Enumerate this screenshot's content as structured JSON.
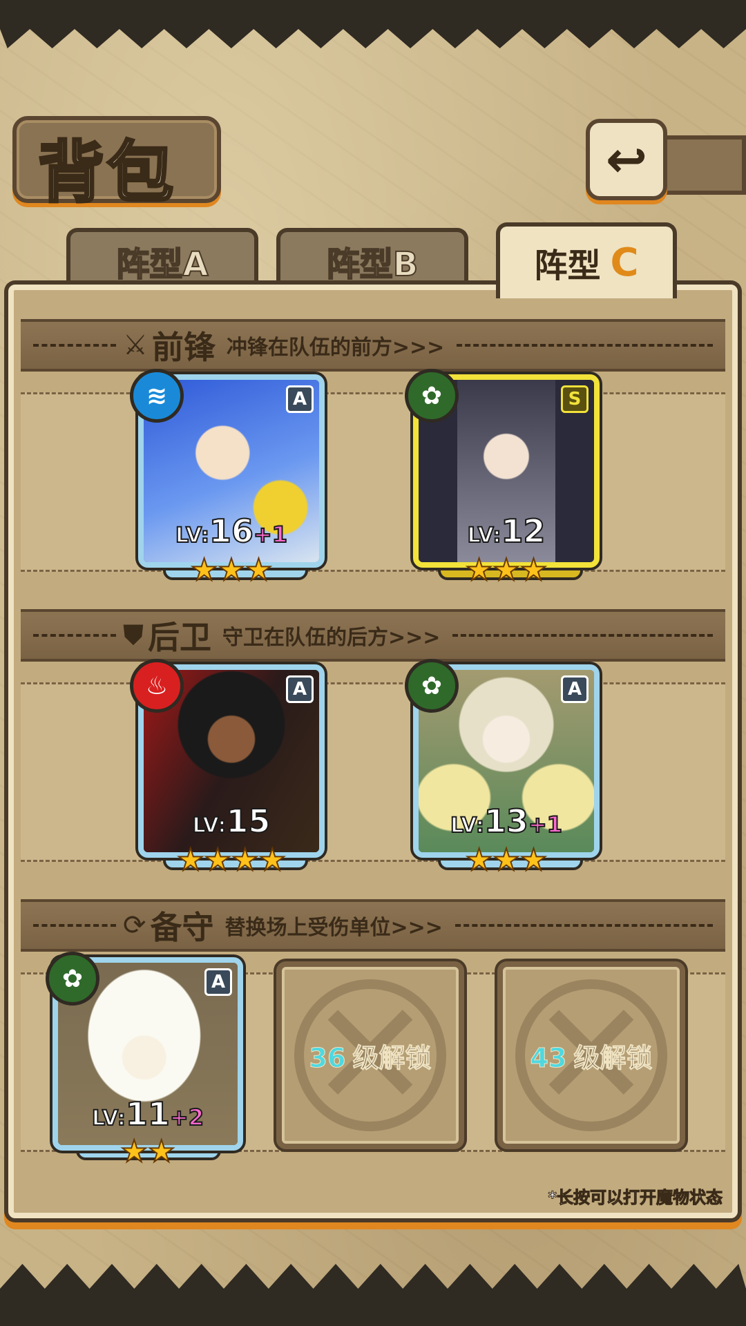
{
  "page": {
    "title": "背包"
  },
  "back_button": {
    "icon": "return-icon",
    "glyph": "↩"
  },
  "tabs": [
    {
      "label": "阵型A",
      "active": false
    },
    {
      "label": "阵型B",
      "active": false
    },
    {
      "label": "阵型",
      "letter": "C",
      "active": true
    }
  ],
  "sections": {
    "front": {
      "icon": "sword-icon",
      "glyph": "⚔",
      "title": "前锋",
      "desc": "冲锋在队伍的前方>>>"
    },
    "back": {
      "icon": "shield-icon",
      "glyph": "⛊",
      "title": "后卫",
      "desc": "守卫在队伍的后方>>>"
    },
    "reserve": {
      "icon": "swap-icon",
      "glyph": "⟳",
      "title": "备守",
      "desc": "替换场上受伤单位>>>"
    }
  },
  "cards": {
    "c1": {
      "element": "water",
      "element_glyph": "≋",
      "rank": "A",
      "lv_prefix": "LV:",
      "lv": "16",
      "plus": "+1",
      "stars": "★★★"
    },
    "c2": {
      "element": "nature",
      "element_glyph": "✿",
      "rank": "S",
      "lv_prefix": "LV:",
      "lv": "12",
      "plus": "",
      "stars": "★★★"
    },
    "c3": {
      "element": "fire",
      "element_glyph": "♨",
      "rank": "A",
      "lv_prefix": "LV:",
      "lv": "15",
      "plus": "",
      "stars": "★★★★"
    },
    "c4": {
      "element": "nature",
      "element_glyph": "✿",
      "rank": "A",
      "lv_prefix": "LV:",
      "lv": "13",
      "plus": "+1",
      "stars": "★★★"
    },
    "c5": {
      "element": "nature",
      "element_glyph": "✿",
      "rank": "A",
      "lv_prefix": "LV:",
      "lv": "11",
      "plus": "+2",
      "stars": "★★"
    }
  },
  "locked_slots": [
    {
      "level": "36",
      "text": "级解锁"
    },
    {
      "level": "43",
      "text": "级解锁"
    }
  ],
  "hint": "*长按可以打开魔物状态",
  "colors": {
    "accent_orange": "#e0871f",
    "rank_a_frame": "#9fd4ec",
    "rank_s_frame": "#f2e23a",
    "plus_pink": "#ff6ad0",
    "unlock_level_cyan": "#4fd8e0"
  }
}
